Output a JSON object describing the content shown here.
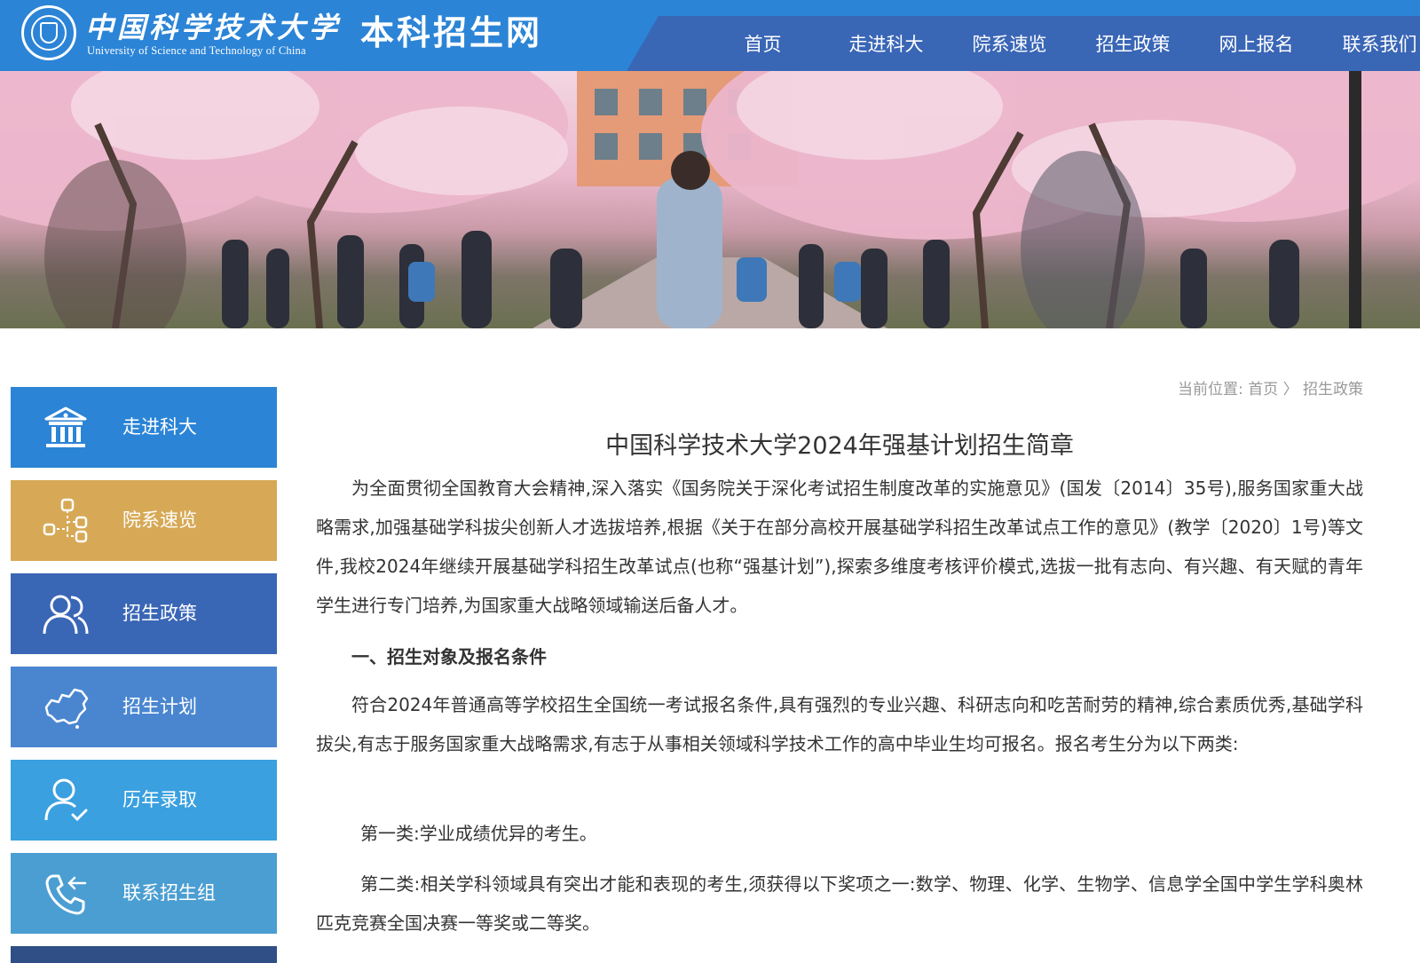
{
  "header": {
    "logo_cn": "中国科学技术大学",
    "logo_en": "University of Science and Technology of China",
    "site_name": "本科招生网",
    "top_strip": "",
    "nav": [
      "首页",
      "走进科大",
      "院系速览",
      "招生政策",
      "网上报名",
      "联系我们"
    ]
  },
  "colors": {
    "header": "#2b84d6",
    "nav_bg": "#3a66b6",
    "side_1": "#2b84d6",
    "side_2": "#d7a956",
    "side_3": "#3a66b6",
    "side_4": "#4a86d0",
    "side_5": "#3aa0e0",
    "side_6": "#4b9ed2",
    "side_7": "#2f4f86"
  },
  "sidebar": {
    "items": [
      {
        "label": "走进科大",
        "icon": "museum-icon"
      },
      {
        "label": "院系速览",
        "icon": "network-icon"
      },
      {
        "label": "招生政策",
        "icon": "users-icon"
      },
      {
        "label": "招生计划",
        "icon": "china-map-icon"
      },
      {
        "label": "历年录取",
        "icon": "user-check-icon"
      },
      {
        "label": "联系招生组",
        "icon": "phone-icon"
      }
    ]
  },
  "breadcrumb": {
    "prefix": "当前位置:",
    "home": "首页",
    "separator": "〉",
    "current": "招生政策"
  },
  "article": {
    "title": "中国科学技术大学2024年强基计划招生简章",
    "intro": "为全面贯彻全国教育大会精神,深入落实《国务院关于深化考试招生制度改革的实施意见》(国发〔2014〕35号),服务国家重大战略需求,加强基础学科拔尖创新人才选拔培养,根据《关于在部分高校开展基础学科招生改革试点工作的意见》(教学〔2020〕1号)等文件,我校2024年继续开展基础学科招生改革试点(也称“强基计划”),探索多维度考核评价模式,选拔一批有志向、有兴趣、有天赋的青年学生进行专门培养,为国家重大战略领域输送后备人才。",
    "section1_heading": "一、招生对象及报名条件",
    "section1_para": "符合2024年普通高等学校招生全国统一考试报名条件,具有强烈的专业兴趣、科研志向和吃苦耐劳的精神,综合素质优秀,基础学科拔尖,有志于服务国家重大战略需求,有志于从事相关领域科学技术工作的高中毕业生均可报名。报名考生分为以下两类:",
    "category1": "第一类:学业成绩优异的考生。",
    "category2": "第二类:相关学科领域具有突出才能和表现的考生,须获得以下奖项之一:数学、物理、化学、生物学、信息学全国中学生学科奥林匹克竞赛全国决赛一等奖或二等奖。"
  }
}
